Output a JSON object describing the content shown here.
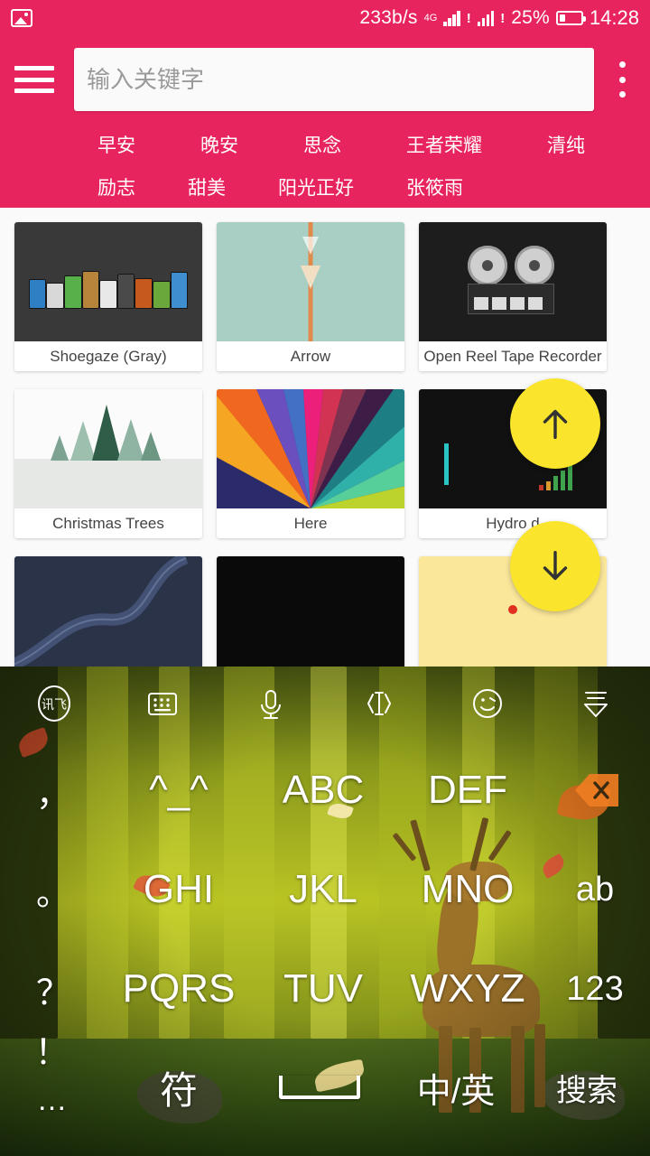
{
  "status_bar": {
    "image_icon": "image-icon",
    "network_speed": "233b/s",
    "network_type": "4G",
    "battery_percent": "25%",
    "time": "14:28",
    "bang1": "!",
    "bang2": "!"
  },
  "header": {
    "bg_color": "#e8245e",
    "menu_icon": "hamburger-menu-icon",
    "overflow_icon": "kebab-menu-icon",
    "search": {
      "value": "",
      "placeholder": "输入关键字"
    },
    "tags_row1": [
      "早安",
      "晚安",
      "思念",
      "王者荣耀",
      "清纯"
    ],
    "tags_row2": [
      "励志",
      "甜美",
      "阳光正好",
      "张筱雨"
    ]
  },
  "content": {
    "cards": [
      {
        "title": "Shoegaze (Gray)",
        "thumb": "shoegaze"
      },
      {
        "title": "Arrow",
        "thumb": "arrow"
      },
      {
        "title": "Open Reel Tape Recorder",
        "thumb": "reel"
      },
      {
        "title": "Christmas Trees",
        "thumb": "trees"
      },
      {
        "title": "Here",
        "thumb": "here"
      },
      {
        "title": "Hydro    d",
        "thumb": "hydro"
      },
      {
        "title": "",
        "thumb": "wire"
      },
      {
        "title": "",
        "thumb": "dark"
      },
      {
        "title": "",
        "thumb": "yellow"
      }
    ]
  },
  "fabs": {
    "color": "#fbe52c",
    "scroll_up": "arrow-up-icon",
    "scroll_down": "arrow-down-icon"
  },
  "keyboard": {
    "toolbar": [
      {
        "icon": "ime-logo-icon"
      },
      {
        "icon": "keyboard-icon"
      },
      {
        "icon": "microphone-icon"
      },
      {
        "icon": "cursor-move-icon"
      },
      {
        "icon": "emoji-icon"
      },
      {
        "icon": "collapse-keyboard-icon"
      }
    ],
    "rows": [
      {
        "punct": "，",
        "keys": [
          "^_^",
          "ABC",
          "DEF"
        ],
        "side": "backspace-icon",
        "side_type": "icon"
      },
      {
        "punct": "。",
        "keys": [
          "GHI",
          "JKL",
          "MNO"
        ],
        "side": "ab",
        "side_type": "text"
      },
      {
        "punct": "？",
        "keys": [
          "PQRS",
          "TUV",
          "WXYZ"
        ],
        "side": "123",
        "side_type": "text"
      }
    ],
    "bottom_row": {
      "exclaim": "！",
      "dots": "…",
      "symbol": "符",
      "space": "space-bar",
      "lang": "中/英",
      "enter": "搜索"
    }
  }
}
